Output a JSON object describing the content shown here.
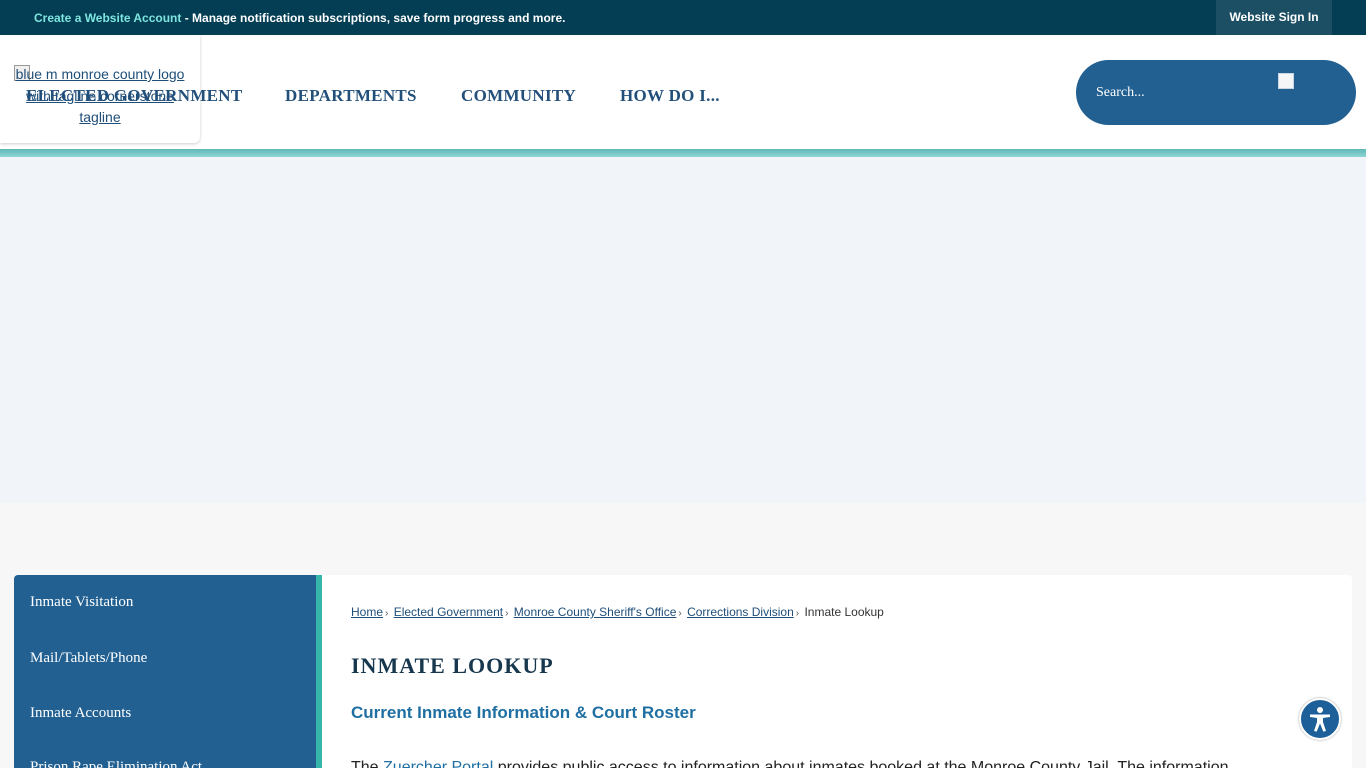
{
  "topbar": {
    "create_link": "Create a Website Account",
    "create_suffix": " - Manage notification subscriptions, save form progress and more.",
    "signin": "Website Sign In"
  },
  "header": {
    "logo_alt": "blue m monroe county logo with tagline cornerstone tagline",
    "nav": [
      "ELECTED GOVERNMENT",
      "DEPARTMENTS",
      "COMMUNITY",
      "HOW DO I..."
    ],
    "search_placeholder": "Search..."
  },
  "sidebar": {
    "items": [
      "Inmate Visitation",
      "Mail/Tablets/Phone",
      "Inmate Accounts",
      "Prison Rape Elimination Act"
    ]
  },
  "content": {
    "breadcrumb": [
      "Home",
      "Elected Government",
      "Monroe County Sheriff's Office",
      "Corrections Division"
    ],
    "breadcrumb_current": "Inmate Lookup",
    "title": "INMATE LOOKUP",
    "subtitle": "Current Inmate Information & Court Roster",
    "para_start": "The ",
    "para_link": "Zuercher Portal",
    "para_rest": " provides public access to information about inmates booked at the Monroe County Jail. The information"
  },
  "colors": {
    "topbar": "#043e54",
    "create_link": "#7fe6df",
    "nav": "#23507a",
    "search_bg": "#226091",
    "sidebar": "#226091",
    "sidebar_accent": "#36b6a8",
    "hero": "#f1f5fa"
  },
  "icons": {
    "search": "search-icon",
    "accessibility": "accessibility-icon"
  }
}
